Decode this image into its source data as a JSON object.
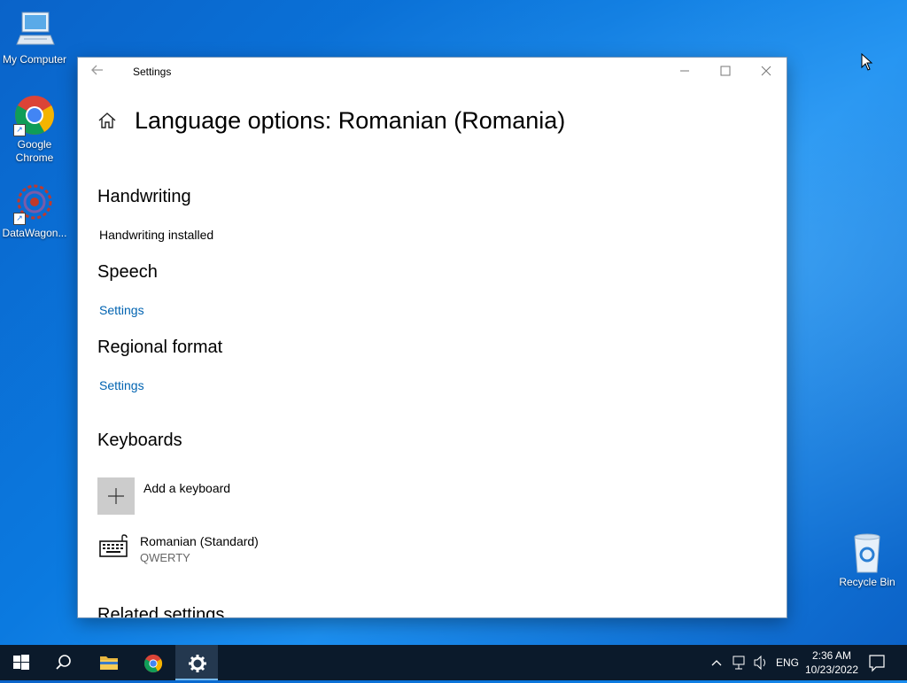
{
  "desktop": {
    "icons": [
      {
        "label": "My Computer"
      },
      {
        "label": "Google\nChrome"
      },
      {
        "label": "DataWagon..."
      },
      {
        "label": "Recycle Bin"
      }
    ]
  },
  "window": {
    "title": "Settings",
    "page_title": "Language options: Romanian (Romania)",
    "sections": {
      "handwriting": {
        "title": "Handwriting",
        "status": "Handwriting installed"
      },
      "speech": {
        "title": "Speech",
        "link": "Settings"
      },
      "regional": {
        "title": "Regional format",
        "link": "Settings"
      },
      "keyboards": {
        "title": "Keyboards",
        "add_label": "Add a keyboard",
        "items": [
          {
            "name": "Romanian (Standard)",
            "layout": "QWERTY"
          }
        ]
      },
      "related": {
        "title": "Related settings"
      }
    }
  },
  "taskbar": {
    "language": "ENG",
    "time": "2:36 AM",
    "date": "10/23/2022"
  },
  "colors": {
    "accent": "#0063b1",
    "taskbar": "#0b1a2b",
    "active_indicator": "#76b9ed"
  }
}
